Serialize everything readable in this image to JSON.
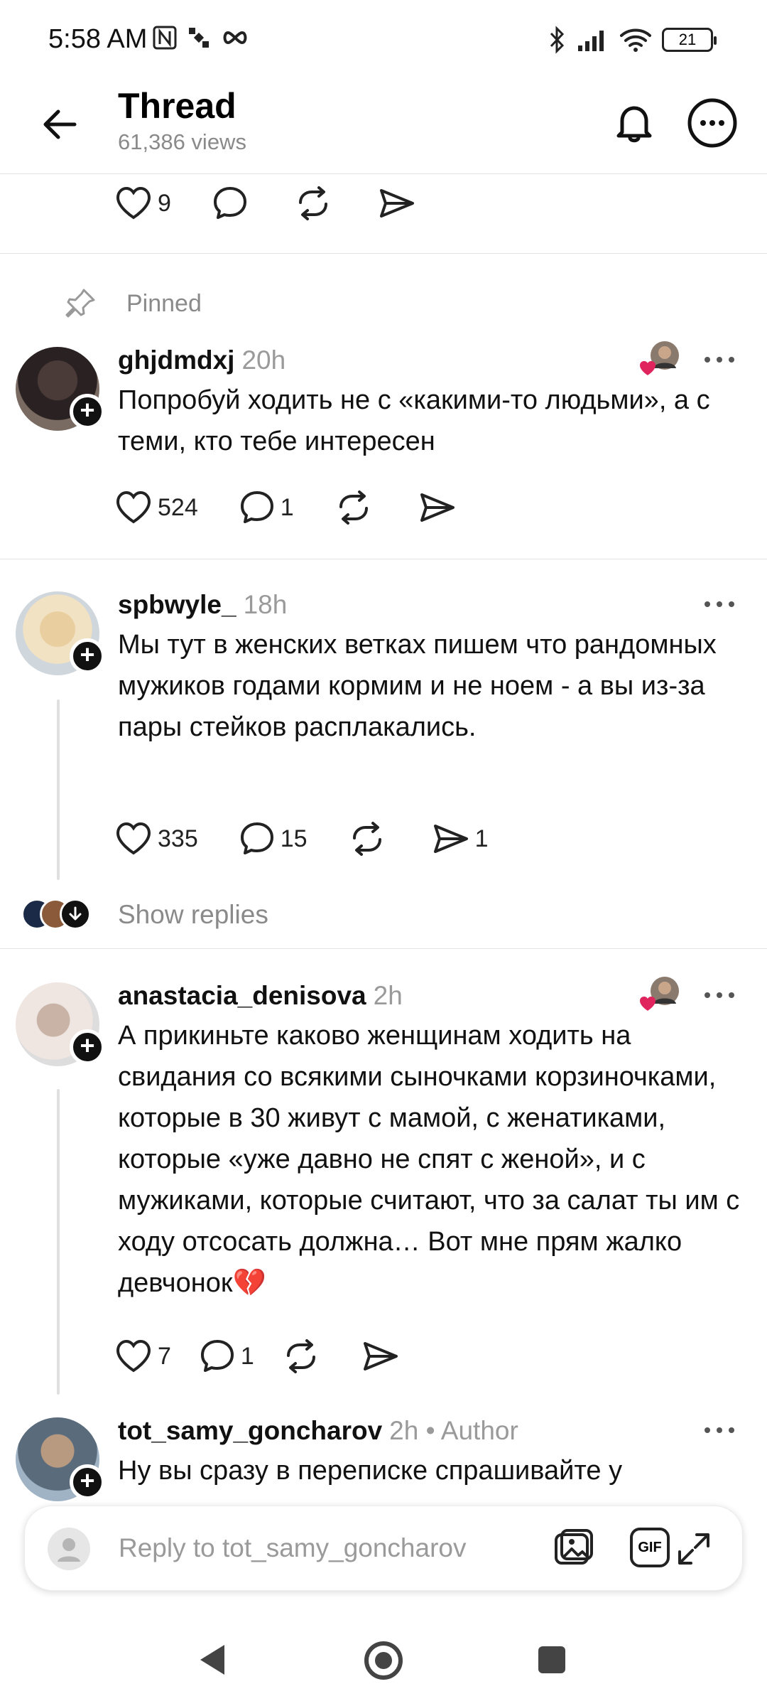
{
  "status": {
    "time": "5:58 AM",
    "battery": "21"
  },
  "header": {
    "title": "Thread",
    "views": "61,386 views"
  },
  "top_actions": {
    "likes": "9"
  },
  "pinned_label": "Pinned",
  "posts": [
    {
      "username": "ghjdmdxj",
      "time": "20h",
      "text": "Попробуй ходить не с «какими-то людьми», а с теми, кто тебе интересен",
      "likes": "524",
      "comments": "1",
      "shares": ""
    },
    {
      "username": "spbwyle_",
      "time": "18h",
      "text": "Мы тут в женских ветках пишем что рандомных мужиков годами кормим и не ноем - а вы из-за пары стейков расплакались.",
      "likes": "335",
      "comments": "15",
      "shares": "1"
    },
    {
      "username": "anastacia_denisova",
      "time": "2h",
      "text": "А прикиньте каково женщинам ходить на свидания со всякими сыночками корзиночками, которые в 30 живут с мамой, с женатиками, которые «уже давно не спят с женой», и с мужиками, которые считают, что за салат ты им с ходу отсосать должна… Вот мне прям жалко девчонок💔",
      "likes": "7",
      "comments": "1",
      "shares": ""
    },
    {
      "username": "tot_samy_goncharov",
      "time": "2h",
      "author": "• Author",
      "text": "Ну вы сразу в переписке спрашивайте у"
    }
  ],
  "show_replies": "Show replies",
  "reply_placeholder": "Reply to tot_samy_goncharov",
  "gif_label": "GIF"
}
